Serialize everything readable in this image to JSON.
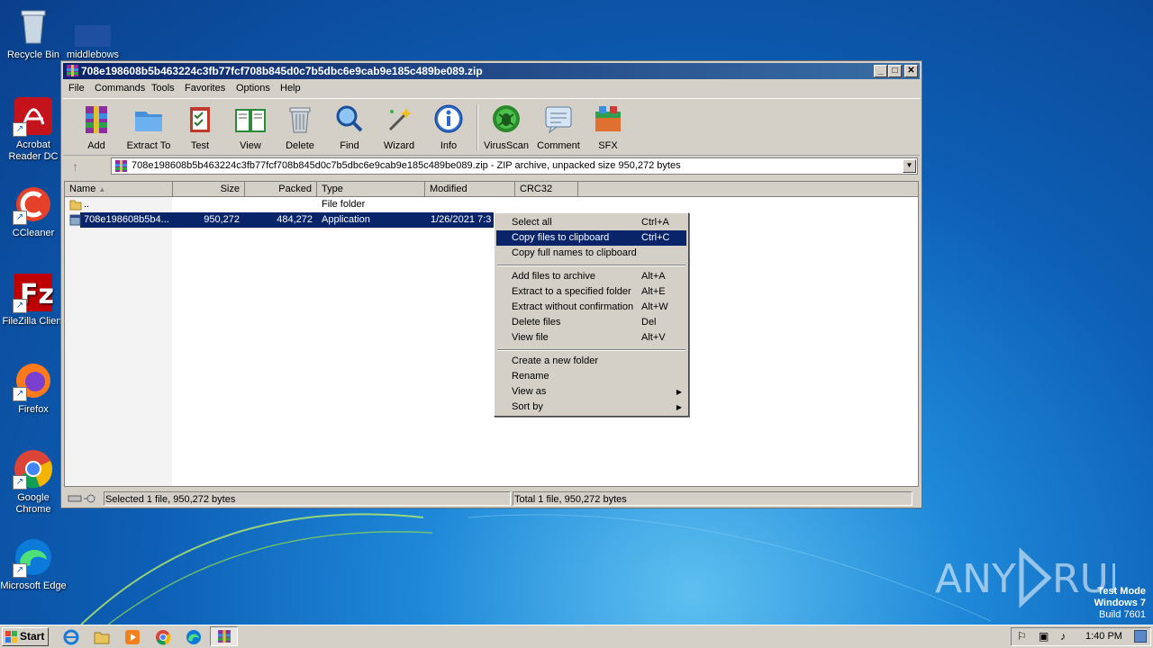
{
  "desktop": {
    "icons": [
      {
        "label": "Recycle Bin",
        "icon": "recycle-bin-icon"
      },
      {
        "label": "middlebows",
        "icon": "file-icon"
      },
      {
        "label": "Acrobat Reader DC",
        "icon": "acrobat-icon"
      },
      {
        "label": "CCleaner",
        "icon": "ccleaner-icon"
      },
      {
        "label": "FileZilla Client",
        "icon": "filezilla-icon"
      },
      {
        "label": "Firefox",
        "icon": "firefox-icon"
      },
      {
        "label": "Google Chrome",
        "icon": "chrome-icon"
      },
      {
        "label": "Microsoft Edge",
        "icon": "edge-icon"
      }
    ],
    "watermark": {
      "line1": "Test Mode",
      "line2": "Windows 7",
      "line3": "Build 7601"
    },
    "brand": "ANY RUN"
  },
  "window": {
    "title": "708e198608b5b463224c3fb77fcf708b845d0c7b5dbc6e9cab9e185c489be089.zip",
    "controls": {
      "minimize": "_",
      "maximize": "□",
      "close": "✕"
    },
    "menu": [
      "File",
      "Commands",
      "Tools",
      "Favorites",
      "Options",
      "Help"
    ],
    "toolbar": [
      {
        "label": "Add",
        "icon": "add-archive-icon"
      },
      {
        "label": "Extract To",
        "icon": "extract-folder-icon"
      },
      {
        "label": "Test",
        "icon": "test-clipboard-icon"
      },
      {
        "label": "View",
        "icon": "view-book-icon"
      },
      {
        "label": "Delete",
        "icon": "trash-icon"
      },
      {
        "label": "Find",
        "icon": "magnifier-icon"
      },
      {
        "label": "Wizard",
        "icon": "wand-icon"
      },
      {
        "label": "Info",
        "icon": "info-icon"
      },
      {
        "label": "VirusScan",
        "icon": "virus-scan-icon"
      },
      {
        "label": "Comment",
        "icon": "comment-icon"
      },
      {
        "label": "SFX",
        "icon": "sfx-icon"
      }
    ],
    "address": "708e198608b5b463224c3fb77fcf708b845d0c7b5dbc6e9cab9e185c489be089.zip - ZIP archive, unpacked size 950,272 bytes",
    "columns": [
      "Name",
      "Size",
      "Packed",
      "Type",
      "Modified",
      "CRC32"
    ],
    "rows": [
      {
        "name": "..",
        "size": "",
        "packed": "",
        "type": "File folder",
        "modified": ""
      },
      {
        "name": "708e198608b5b4...",
        "size": "950,272",
        "packed": "484,272",
        "type": "Application",
        "modified": "1/26/2021 7:3"
      }
    ],
    "status_left": "Selected 1 file, 950,272 bytes",
    "status_right": "Total 1 file, 950,272 bytes"
  },
  "context_menu": {
    "groups": [
      [
        {
          "label": "Select all",
          "shortcut": "Ctrl+A"
        },
        {
          "label": "Copy files to clipboard",
          "shortcut": "Ctrl+C",
          "highlighted": true
        },
        {
          "label": "Copy full names to clipboard",
          "shortcut": ""
        }
      ],
      [
        {
          "label": "Add files to archive",
          "shortcut": "Alt+A"
        },
        {
          "label": "Extract to a specified folder",
          "shortcut": "Alt+E"
        },
        {
          "label": "Extract without confirmation",
          "shortcut": "Alt+W"
        },
        {
          "label": "Delete files",
          "shortcut": "Del"
        },
        {
          "label": "View file",
          "shortcut": "Alt+V"
        }
      ],
      [
        {
          "label": "Create a new folder",
          "shortcut": ""
        },
        {
          "label": "Rename",
          "shortcut": ""
        },
        {
          "label": "View as",
          "shortcut": "",
          "submenu": true
        },
        {
          "label": "Sort by",
          "shortcut": "",
          "submenu": true
        }
      ]
    ]
  },
  "taskbar": {
    "start_label": "Start",
    "clock": "1:40 PM",
    "pinned": [
      "ie-icon",
      "explorer-icon",
      "media-player-icon",
      "chrome-icon",
      "edge-icon",
      "winrar-icon"
    ]
  }
}
